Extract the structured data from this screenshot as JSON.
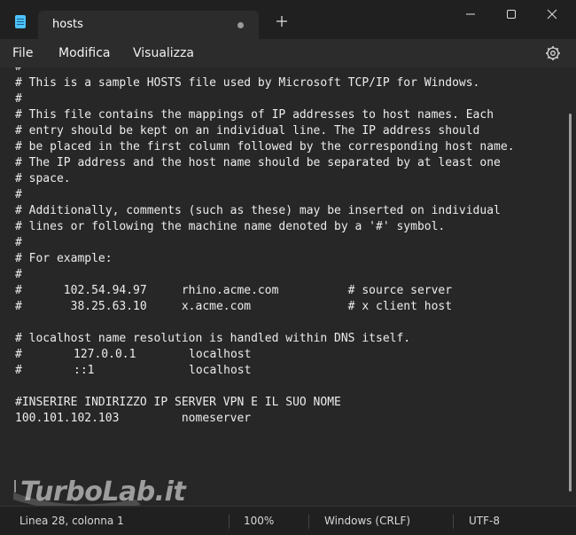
{
  "tab": {
    "title": "hosts"
  },
  "menu": {
    "file": "File",
    "modifica": "Modifica",
    "visualizza": "Visualizza"
  },
  "editor": {
    "lines": [
      "#",
      "# This is a sample HOSTS file used by Microsoft TCP/IP for Windows.",
      "#",
      "# This file contains the mappings of IP addresses to host names. Each",
      "# entry should be kept on an individual line. The IP address should",
      "# be placed in the first column followed by the corresponding host name.",
      "# The IP address and the host name should be separated by at least one",
      "# space.",
      "#",
      "# Additionally, comments (such as these) may be inserted on individual",
      "# lines or following the machine name denoted by a '#' symbol.",
      "#",
      "# For example:",
      "#",
      "#      102.54.94.97     rhino.acme.com          # source server",
      "#       38.25.63.10     x.acme.com              # x client host",
      "",
      "# localhost name resolution is handled within DNS itself.",
      "#\t127.0.0.1       localhost",
      "#\t::1             localhost",
      "",
      "#INSERIRE INDIRIZZO IP SERVER VPN E IL SUO NOME",
      "100.101.102.103         nomeserver"
    ]
  },
  "status": {
    "position": "Linea 28, colonna 1",
    "zoom": "100%",
    "line_ending": "Windows (CRLF)",
    "encoding": "UTF-8"
  },
  "watermark": {
    "text": "TurboLab.it"
  },
  "icons": {
    "app": "notepad-icon",
    "minimize": "minimize-icon",
    "maximize": "maximize-icon",
    "close": "close-icon",
    "settings": "gear-icon",
    "new_tab": "plus-icon"
  }
}
